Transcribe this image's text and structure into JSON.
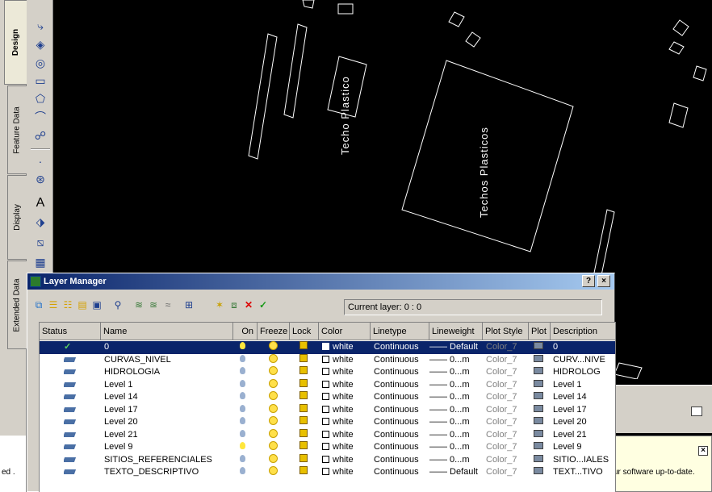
{
  "side_tabs": [
    "Design",
    "Feature Data",
    "Display",
    "Extended Data"
  ],
  "drawing": {
    "labels": [
      "Techo Plastico",
      "Techos Plasticos"
    ]
  },
  "layer_manager": {
    "title": "Layer Manager",
    "help_label": "?",
    "close_label": "×",
    "current_layer": "Current layer: 0 : 0",
    "columns": [
      "Status",
      "Name",
      "On",
      "Freeze",
      "Lock",
      "Color",
      "Linetype",
      "Lineweight",
      "Plot Style",
      "Plot",
      "Description"
    ],
    "rows": [
      {
        "name": "0",
        "color": "white",
        "linetype": "Continuous",
        "lineweight": "—— Default",
        "plot_style": "Color_7",
        "description": "0",
        "current": true
      },
      {
        "name": "CURVAS_NIVEL",
        "color": "white",
        "linetype": "Continuous",
        "lineweight": "—— 0...m",
        "plot_style": "Color_7",
        "description": "CURV...NIVE"
      },
      {
        "name": "HIDROLOGIA",
        "color": "white",
        "linetype": "Continuous",
        "lineweight": "—— 0...m",
        "plot_style": "Color_7",
        "description": "HIDROLOG"
      },
      {
        "name": "Level 1",
        "color": "white",
        "linetype": "Continuous",
        "lineweight": "—— 0...m",
        "plot_style": "Color_7",
        "description": "Level 1"
      },
      {
        "name": "Level 14",
        "color": "white",
        "linetype": "Continuous",
        "lineweight": "—— 0...m",
        "plot_style": "Color_7",
        "description": "Level 14"
      },
      {
        "name": "Level 17",
        "color": "white",
        "linetype": "Continuous",
        "lineweight": "—— 0...m",
        "plot_style": "Color_7",
        "description": "Level 17"
      },
      {
        "name": "Level 20",
        "color": "white",
        "linetype": "Continuous",
        "lineweight": "—— 0...m",
        "plot_style": "Color_7",
        "description": "Level 20"
      },
      {
        "name": "Level 21",
        "color": "white",
        "linetype": "Continuous",
        "lineweight": "—— 0...m",
        "plot_style": "Color_7",
        "description": "Level 21"
      },
      {
        "name": "Level 9",
        "color": "white",
        "linetype": "Continuous",
        "lineweight": "—— 0...m",
        "plot_style": "Color_7",
        "description": "Level 9"
      },
      {
        "name": "SITIOS_REFERENCIALES",
        "color": "white",
        "linetype": "Continuous",
        "lineweight": "—— 0...m",
        "plot_style": "Color_7",
        "description": "SITIO...IALES"
      },
      {
        "name": "TEXTO_DESCRIPTIVO",
        "color": "white",
        "linetype": "Continuous",
        "lineweight": "—— Default",
        "plot_style": "Color_7",
        "description": "TEXT...TIVO"
      }
    ]
  },
  "notification": {
    "text": "ur software up-to-date.",
    "close_label": "×"
  },
  "command_line": {
    "text": "ed ."
  },
  "colors": {
    "canvas": "#000000",
    "selection": "#0a246a",
    "panel": "#d4d0c8",
    "notify": "#ffffe1"
  }
}
